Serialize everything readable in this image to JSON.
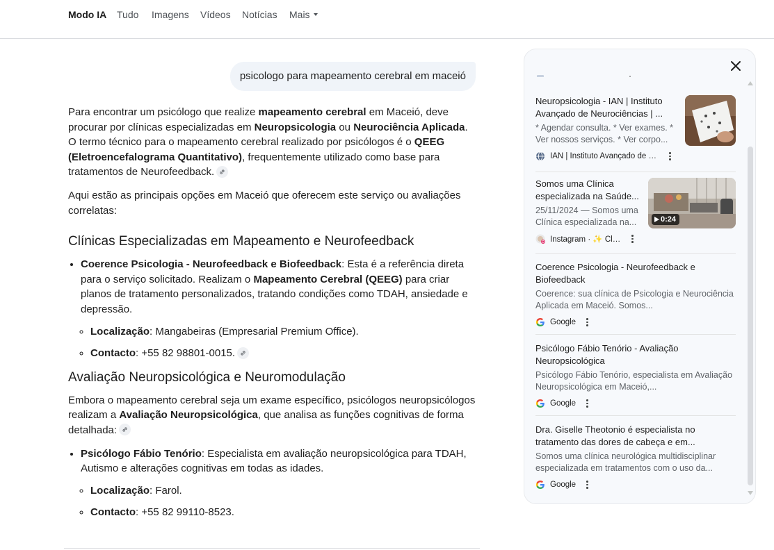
{
  "nav": {
    "tabs": [
      "Modo IA",
      "Tudo",
      "Imagens",
      "Vídeos",
      "Notícias",
      "Mais"
    ],
    "active": "Modo IA"
  },
  "query": "psicologo para mapeamento cerebral em maceió",
  "answer": {
    "intro": {
      "t1": "Para encontrar um psicólogo que realize ",
      "b1": "mapeamento cerebral",
      "t2": " em Maceió, deve procurar por clínicas especializadas em ",
      "b2": "Neuropsicologia",
      "t3": " ou ",
      "b3": "Neurociência Aplicada",
      "t4": ". O termo técnico para o mapeamento cerebral realizado por psicólogos é o ",
      "b4": "QEEG (Eletroencefalograma Quantitativo)",
      "t5": ", frequentemente utilizado como base para tratamentos de Neurofeedback."
    },
    "options_text": "Aqui estão as principais opções em Maceió que oferecem este serviço ou avaliações correlatas:",
    "section1": {
      "heading": "Clínicas Especializadas em Mapeamento e Neurofeedback",
      "item": {
        "name": "Coerence Psicologia - Neurofeedback e Biofeedback",
        "t1": ": Esta é a referência direta para o serviço solicitado. Realizam o ",
        "b1": "Mapeamento Cerebral (QEEG)",
        "t2": " para criar planos de tratamento personalizados, tratando condições como TDAH, ansiedade e depressão.",
        "loc_label": "Localização",
        "loc_value": ": Mangabeiras (Empresarial Premium Office).",
        "contact_label": "Contacto",
        "contact_value": ": +55 82 98801-0015."
      }
    },
    "section2": {
      "heading": "Avaliação Neuropsicológica e Neuromodulação",
      "p1": "Embora o mapeamento cerebral seja um exame específico, psicólogos neuropsicólogos realizam a ",
      "b1": "Avaliação Neuropsicológica",
      "p2": ", que analisa as funções cognitivas de forma detalhada:",
      "item": {
        "name": "Psicólogo Fábio Tenório",
        "text": ": Especialista em avaliação neuropsicológica para TDAH, Autismo e alterações cognitivas em todas as idades.",
        "loc_label": "Localização",
        "loc_value": ": Farol.",
        "contact_label": "Contacto",
        "contact_value": ": +55 82 99110-8523."
      }
    }
  },
  "sources": [
    {
      "title": "Neuropsicologia - IAN | Instituto Avançado de Neurociências | ...",
      "snippet": "* Agendar consulta. * Ver exames. * Ver nossos serviços. * Ver corpo...",
      "source": "IAN | Instituto Avançado de N...",
      "favicon": "globe-icon"
    },
    {
      "title": "Somos uma Clínica especializada na Saúde...",
      "snippet": "25/11/2024 — Somos uma Clínica especializada na...",
      "source": "Instagram · ✨ Clín...",
      "favicon": "instagram-icon",
      "duration": "0:24"
    },
    {
      "title": "Coerence Psicologia - Neurofeedback e Biofeedback",
      "snippet": "Coerence: sua clínica de Psicologia e Neurociência Aplicada em Maceió. Somos...",
      "source": "Google",
      "favicon": "google-icon"
    },
    {
      "title": "Psicólogo Fábio Tenório - Avaliação Neuropsicológica",
      "snippet": "Psicólogo Fábio Tenório, especialista em Avaliação Neuropsicológica em Maceió,...",
      "source": "Google",
      "favicon": "google-icon"
    },
    {
      "title": "Dra. Giselle Theotonio é especialista no tratamento das dores de cabeça e em...",
      "snippet": "Somos uma clínica neurológica multidisciplinar especializada em tratamentos com o uso da...",
      "source": "Google",
      "favicon": "google-icon"
    }
  ],
  "colors": {
    "accent_bubble": "#f0f4f9",
    "panel_bg": "#f7f9fc",
    "text": "#1f1f1f",
    "muted": "#5f6368"
  }
}
